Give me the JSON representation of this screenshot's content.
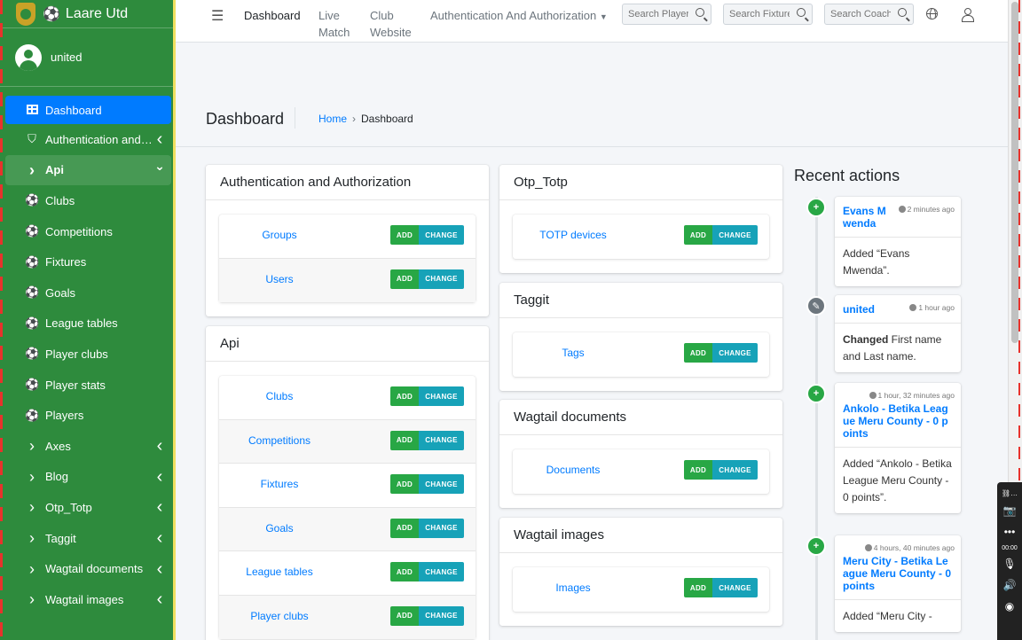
{
  "sidebar": {
    "brand": "Laare Utd",
    "user": "united",
    "items": [
      {
        "label": "Dashboard",
        "icon": "grid-icon",
        "state": "active"
      },
      {
        "label": "Authentication and Authorization",
        "icon": "shield-icon",
        "arrow": "‹"
      },
      {
        "label": "Api",
        "icon": "chevron-right-icon",
        "arrow": "⌄",
        "state": "open"
      },
      {
        "label": "Clubs",
        "icon": "ball-icon"
      },
      {
        "label": "Competitions",
        "icon": "ball-icon"
      },
      {
        "label": "Fixtures",
        "icon": "ball-icon"
      },
      {
        "label": "Goals",
        "icon": "ball-icon"
      },
      {
        "label": "League tables",
        "icon": "ball-icon"
      },
      {
        "label": "Player clubs",
        "icon": "ball-icon"
      },
      {
        "label": "Player stats",
        "icon": "ball-icon"
      },
      {
        "label": "Players",
        "icon": "ball-icon"
      },
      {
        "label": "Axes",
        "icon": "chevron-right-icon",
        "arrow": "‹"
      },
      {
        "label": "Blog",
        "icon": "chevron-right-icon",
        "arrow": "‹"
      },
      {
        "label": "Otp_Totp",
        "icon": "chevron-right-icon",
        "arrow": "‹"
      },
      {
        "label": "Taggit",
        "icon": "chevron-right-icon",
        "arrow": "‹"
      },
      {
        "label": "Wagtail documents",
        "icon": "chevron-right-icon",
        "arrow": "‹"
      },
      {
        "label": "Wagtail images",
        "icon": "chevron-right-icon",
        "arrow": "‹"
      }
    ]
  },
  "topbar": {
    "links": [
      "Dashboard",
      "Live Match",
      "Club Website"
    ],
    "dropdown": "Authentication And Authorization",
    "searches": [
      "Search Players",
      "Search Fixtures",
      "Search Coaches"
    ]
  },
  "header": {
    "title": "Dashboard",
    "breadcrumb_home": "Home",
    "breadcrumb_current": "Dashboard"
  },
  "buttons": {
    "add": "ADD",
    "change": "CHANGE"
  },
  "apps": [
    {
      "title": "Authentication and Authorization",
      "models": [
        "Groups",
        "Users"
      ]
    },
    {
      "title": "Api",
      "models": [
        "Clubs",
        "Competitions",
        "Fixtures",
        "Goals",
        "League tables",
        "Player clubs"
      ]
    },
    {
      "title": "Otp_Totp",
      "models": [
        "TOTP devices"
      ]
    },
    {
      "title": "Taggit",
      "models": [
        "Tags"
      ]
    },
    {
      "title": "Wagtail documents",
      "models": [
        "Documents"
      ]
    },
    {
      "title": "Wagtail images",
      "models": [
        "Images"
      ]
    }
  ],
  "recent": {
    "title": "Recent actions",
    "actions": [
      {
        "who": "Evans Mwenda",
        "when": "2 minutes ago",
        "type": "added",
        "prefix": "",
        "text": "Added “Evans Mwenda”."
      },
      {
        "who": "united",
        "when": "1 hour ago",
        "type": "changed",
        "prefix": "Changed",
        "text": " First name and Last name."
      },
      {
        "who": "Ankolo - Betika League Meru County - 0 points",
        "when": "1 hour, 32 minutes ago",
        "type": "added",
        "prefix": "",
        "text": "Added “Ankolo - Betika League Meru County - 0 points”."
      },
      {
        "who": "Meru City - Betika League Meru County - 0 points",
        "when": "4 hours, 40 minutes ago",
        "type": "added",
        "prefix": "",
        "text": "Added “Meru City -"
      }
    ]
  },
  "recorder": {
    "time": "00:00"
  }
}
